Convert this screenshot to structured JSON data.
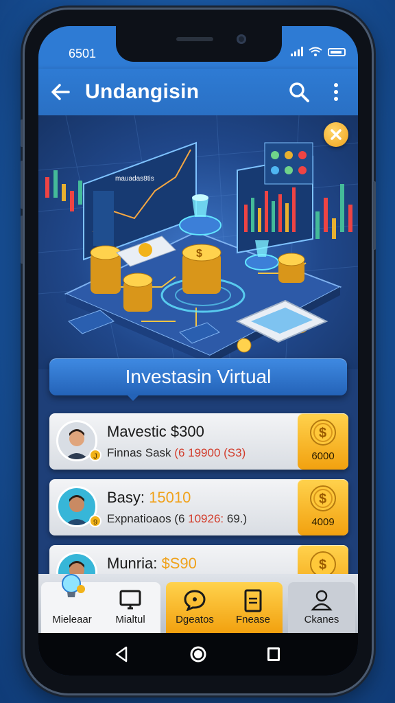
{
  "status": {
    "time": "6501"
  },
  "appbar": {
    "title": "Undangisin"
  },
  "hero": {
    "screen_text": "mauadas8tis"
  },
  "section": {
    "title": "Investasin Virtual"
  },
  "list": {
    "items": [
      {
        "name": "Mavestic",
        "amount": "$300",
        "sub_prefix": "Finnas Sask",
        "sub_red": "(6 19900",
        "sub_tail": "(S3)",
        "coin_value": "6000"
      },
      {
        "name": "Basy:",
        "amount": "15010",
        "sub_prefix": "Expnatioaos (6",
        "sub_red": "10926:",
        "sub_tail": "69.)",
        "coin_value": "4009"
      },
      {
        "name": "Munria:",
        "amount": "$S90",
        "sub_prefix": "",
        "sub_red": "",
        "sub_tail": "",
        "coin_value": ""
      }
    ]
  },
  "tabs": [
    {
      "label": "Mieleaar",
      "icon": "lightbulb-icon"
    },
    {
      "label": "Mialtul",
      "icon": "monitor-icon"
    },
    {
      "label": "Dgeatos",
      "icon": "chat-icon"
    },
    {
      "label": "Fnease",
      "icon": "document-icon"
    },
    {
      "label": "Ckanes",
      "icon": "user-icon"
    }
  ],
  "colors": {
    "accent": "#2e7bd4",
    "gold": "#f2a10f",
    "red": "#d23b2a"
  }
}
